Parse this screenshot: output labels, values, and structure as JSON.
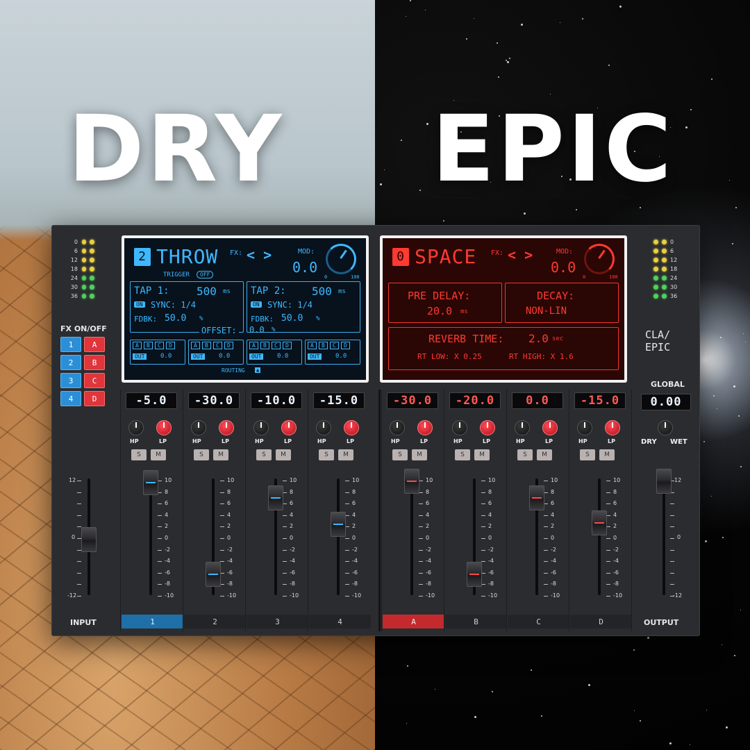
{
  "headline": {
    "left": "DRY",
    "right": "EPIC"
  },
  "input_meter": {
    "labels": [
      "0",
      "6",
      "12",
      "18",
      "24",
      "30",
      "36"
    ]
  },
  "output_meter": {
    "labels": [
      "0",
      "6",
      "12",
      "18",
      "24",
      "30",
      "36"
    ]
  },
  "fx_onoff": {
    "label": "FX ON/OFF",
    "buttons": [
      {
        "label": "1"
      },
      {
        "label": "A"
      },
      {
        "label": "2"
      },
      {
        "label": "B"
      },
      {
        "label": "3"
      },
      {
        "label": "C"
      },
      {
        "label": "4"
      },
      {
        "label": "D"
      }
    ]
  },
  "throw_screen": {
    "number": "2",
    "title": "THROW",
    "fx_label": "FX:",
    "arrows": "< >",
    "mod_label": "MOD:",
    "mod_value": "0.0",
    "mod_min": "0",
    "mod_max": "100",
    "trigger_label": "TRIGGER",
    "trigger_value": "OFF",
    "tap1_label": "TAP 1:",
    "tap1_value": "500",
    "tap1_unit": "ms",
    "tap2_label": "TAP 2:",
    "tap2_value": "500",
    "tap2_unit": "ms",
    "on_label": "ON",
    "sync1": "SYNC: 1/4",
    "sync2": "SYNC: 1/4",
    "fdbk1_label": "FDBK:",
    "fdbk1_value": "50.0",
    "fdbk1_unit": "%",
    "fdbk2_label": "FDBK:",
    "fdbk2_value": "50.0",
    "fdbk2_unit": "%",
    "offset_label": "OFFSET:",
    "offset_value": "0.0",
    "offset_unit": "%",
    "routing_letters": [
      "A",
      "B",
      "C",
      "D"
    ],
    "out_label": "OUT",
    "out_value": "0.0",
    "routing_label": "ROUTING"
  },
  "space_screen": {
    "number": "0",
    "title": "SPACE",
    "fx_label": "FX:",
    "arrows": "< >",
    "mod_label": "MOD:",
    "mod_value": "0.0",
    "mod_min": "0",
    "mod_max": "100",
    "predelay_label": "PRE DELAY:",
    "predelay_value": "20.0",
    "predelay_unit": "ms",
    "decay_label": "DECAY:",
    "decay_value": "NON-LIN",
    "reverb_time_label": "REVERB TIME:",
    "reverb_time_value": "2.0",
    "reverb_time_unit": "sec",
    "rt_low": "RT LOW: X 0.25",
    "rt_high": "RT HIGH: X 1.6"
  },
  "brand": {
    "line1": "CLA/",
    "line2": "EPIC"
  },
  "global": {
    "label": "GLOBAL",
    "value": "0.00",
    "dry_label": "DRY",
    "wet_label": "WET"
  },
  "channels": [
    {
      "name": "1",
      "level": "-5.0",
      "hp": "HP",
      "lp": "LP",
      "solo": "S",
      "mute": "M"
    },
    {
      "name": "2",
      "level": "-30.0",
      "hp": "HP",
      "lp": "LP",
      "solo": "S",
      "mute": "M"
    },
    {
      "name": "3",
      "level": "-10.0",
      "hp": "HP",
      "lp": "LP",
      "solo": "S",
      "mute": "M"
    },
    {
      "name": "4",
      "level": "-15.0",
      "hp": "HP",
      "lp": "LP",
      "solo": "S",
      "mute": "M"
    },
    {
      "name": "A",
      "level": "-30.0",
      "hp": "HP",
      "lp": "LP",
      "solo": "S",
      "mute": "M"
    },
    {
      "name": "B",
      "level": "-20.0",
      "hp": "HP",
      "lp": "LP",
      "solo": "S",
      "mute": "M"
    },
    {
      "name": "C",
      "level": "0.0",
      "hp": "HP",
      "lp": "LP",
      "solo": "S",
      "mute": "M"
    },
    {
      "name": "D",
      "level": "-15.0",
      "hp": "HP",
      "lp": "LP",
      "solo": "S",
      "mute": "M"
    }
  ],
  "fader_scale": [
    "10",
    "8",
    "6",
    "4",
    "2",
    "0",
    "-2",
    "-4",
    "-6",
    "-8",
    "-10"
  ],
  "input": {
    "label": "INPUT",
    "scale_top": "12",
    "scale_mid": "0",
    "scale_bottom": "-12"
  },
  "output": {
    "label": "OUTPUT",
    "scale_top": "12",
    "scale_mid": "0",
    "scale_bottom": "-12"
  }
}
